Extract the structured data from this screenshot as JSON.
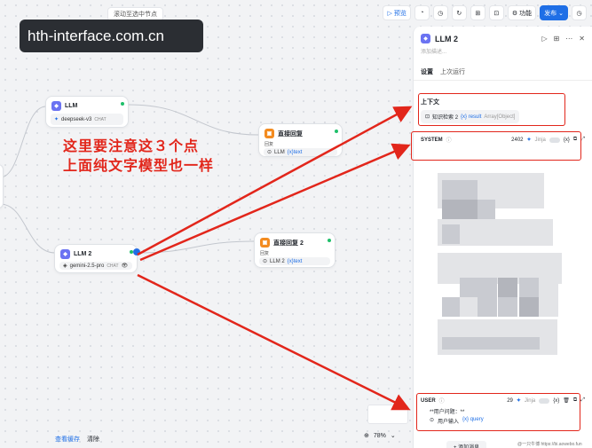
{
  "canvas": {
    "top_hint": "滚动至选中节点",
    "watermark": "hth-interface.com.cn",
    "annotation_line1": "这里要注意这３个点",
    "annotation_line2": "上面纯文字模型也一样"
  },
  "toolbar": {
    "preview": "预览",
    "features": "功能",
    "publish": "发布"
  },
  "nodes": {
    "llm1": {
      "title": "LLM",
      "model": "deepseek-v3",
      "mode": "CHAT"
    },
    "reply1": {
      "title": "直接回复",
      "label": "回复",
      "src": "LLM",
      "var": "{x}text"
    },
    "llm2": {
      "title": "LLM 2",
      "model": "gemini-2.5-pro",
      "mode": "CHAT"
    },
    "reply2": {
      "title": "直接回复 2",
      "label": "回复",
      "src": "LLM 2",
      "var": "{x}text"
    }
  },
  "bottom": {
    "view_cache": "查看缓存",
    "clear": "清除",
    "zoom": "78%"
  },
  "panel": {
    "title": "LLM 2",
    "description_placeholder": "添加描述...",
    "tabs": [
      "设置",
      "上次运行"
    ],
    "context_label": "上下文",
    "context_chip_src": "知识检索 2",
    "context_chip_var": "{x} result",
    "context_chip_type": "Array[Object]",
    "system_role": "SYSTEM",
    "system_count": "2402",
    "jinja": "Jinja",
    "user_role": "USER",
    "user_count": "29",
    "user_text": "**用户问题：**",
    "user_var_src": "用户输入",
    "user_var": "{x} query",
    "add_message": "+ 添加消息",
    "credit": "@一只牛博 https://bi.aowebo.fun"
  },
  "colors": {
    "accent": "#1f6fe6",
    "annotation": "#e2261b",
    "success": "#1fbf6a",
    "llm_icon": "#6b73f2",
    "reply_icon": "#f38b1f"
  }
}
